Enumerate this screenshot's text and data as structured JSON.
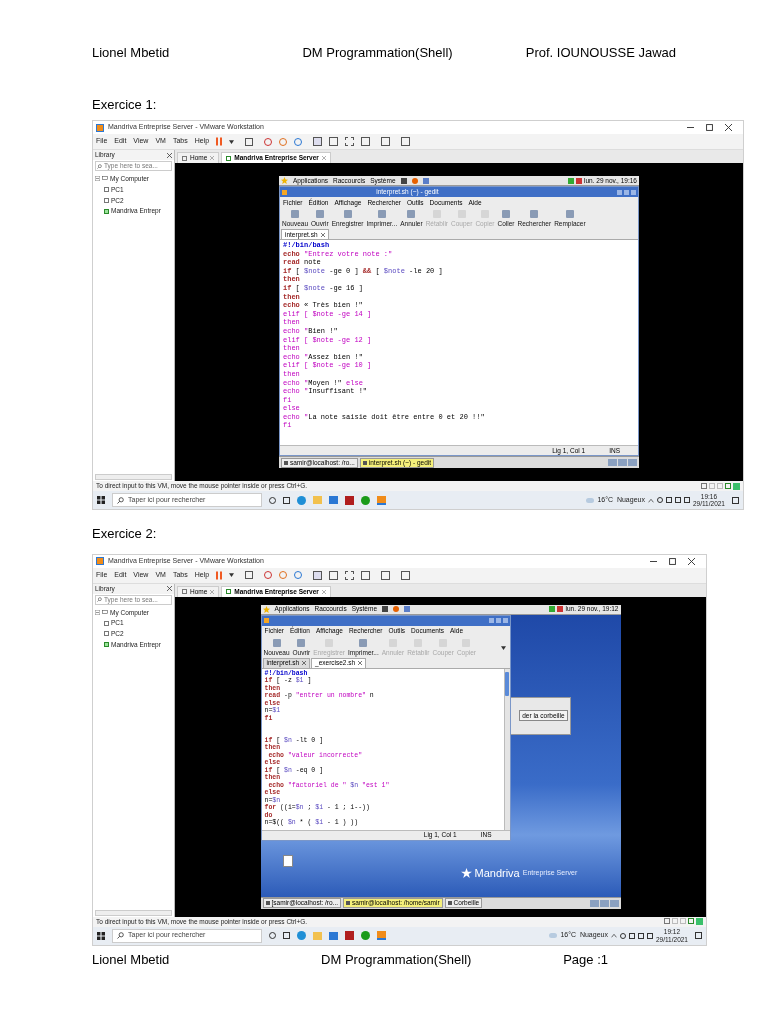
{
  "header": {
    "left": "Lionel Mbetid",
    "center": "DM Programmation(Shell)",
    "right": "Prof. IOUNOUSSE Jawad"
  },
  "sections": [
    {
      "title": "Exercice 1:",
      "screenshot": {
        "window_title": "Mandriva Entreprise Server - VMware Workstation",
        "menu": [
          "File",
          "Edit",
          "View",
          "VM",
          "Tabs",
          "Help"
        ],
        "library": {
          "title": "Library",
          "search_placeholder": "Type here to sea...",
          "tree": [
            {
              "label": "My Computer",
              "expanded": true,
              "children": [
                {
                  "label": "PC1",
                  "running": false
                },
                {
                  "label": "PC2",
                  "running": false
                },
                {
                  "label": "Mandriva Entrepr",
                  "running": true
                }
              ]
            }
          ]
        },
        "tabs": [
          {
            "label": "Home",
            "selected": false
          },
          {
            "label": "Mandriva Entreprise Server",
            "selected": true
          }
        ],
        "guest": {
          "kind": "maximized",
          "panel_menus": [
            "Applications",
            "Raccourcis",
            "Système"
          ],
          "panel_clock": "lun. 29 nov., 19:16",
          "gedit": {
            "title": "interpret.sh (~) - gedit",
            "menu": [
              "Fichier",
              "Édition",
              "Affichage",
              "Rechercher",
              "Outils",
              "Documents",
              "Aide"
            ],
            "toolbar": [
              {
                "label": "Nouveau",
                "disabled": false
              },
              {
                "label": "Ouvrir",
                "disabled": false
              },
              {
                "label": "Enregistrer",
                "disabled": false
              },
              {
                "label": "Imprimer...",
                "disabled": false
              },
              {
                "label": "Annuler",
                "disabled": false
              },
              {
                "label": "Rétablir",
                "disabled": true
              },
              {
                "label": "Couper",
                "disabled": true
              },
              {
                "label": "Copier",
                "disabled": true
              },
              {
                "label": "Coller",
                "disabled": false
              },
              {
                "label": "Rechercher",
                "disabled": false
              },
              {
                "label": "Remplacer",
                "disabled": false
              }
            ],
            "doc_tabs": [
              {
                "label": "interpret.sh",
                "selected": true
              }
            ],
            "lines": [
              {
                "kind": "code",
                "tokens": [
                  {
                    "kind": "shebang",
                    "text": "#!/bin/bash"
                  }
                ]
              },
              {
                "kind": "code",
                "tokens": [
                  {
                    "kind": "kw",
                    "text": "echo"
                  },
                  {
                    "kind": "str",
                    "text": " \"Entrez votre note :\""
                  }
                ]
              },
              {
                "kind": "code",
                "tokens": [
                  {
                    "kind": "kw",
                    "text": "read"
                  },
                  {
                    "kind": "plain",
                    "text": " note"
                  }
                ]
              },
              {
                "kind": "code",
                "tokens": [
                  {
                    "kind": "kw",
                    "text": "if"
                  },
                  {
                    "kind": "plain",
                    "text": " [ "
                  },
                  {
                    "kind": "var",
                    "text": "$note"
                  },
                  {
                    "kind": "plain",
                    "text": " -ge 0 ] "
                  },
                  {
                    "kind": "kw",
                    "text": "&&"
                  },
                  {
                    "kind": "plain",
                    "text": " [ "
                  },
                  {
                    "kind": "var",
                    "text": "$note"
                  },
                  {
                    "kind": "plain",
                    "text": " -le 20 ]"
                  }
                ]
              },
              {
                "kind": "code",
                "tokens": [
                  {
                    "kind": "kw",
                    "text": "then"
                  }
                ]
              },
              {
                "kind": "code",
                "tokens": [
                  {
                    "kind": "kw",
                    "text": "if"
                  },
                  {
                    "kind": "plain",
                    "text": " [ "
                  },
                  {
                    "kind": "var",
                    "text": "$note"
                  },
                  {
                    "kind": "plain",
                    "text": " -ge 16 ]"
                  }
                ]
              },
              {
                "kind": "code",
                "tokens": [
                  {
                    "kind": "kw",
                    "text": "then"
                  }
                ]
              },
              {
                "kind": "code",
                "tokens": [
                  {
                    "kind": "kw",
                    "text": "echo"
                  },
                  {
                    "kind": "plain",
                    "text": " « Très bien !\""
                  }
                ]
              },
              {
                "kind": "code",
                "tokens": [
                  {
                    "kind": "str",
                    "text": "elif [ $note -ge 14 ]"
                  }
                ]
              },
              {
                "kind": "code",
                "tokens": [
                  {
                    "kind": "str",
                    "text": "then"
                  }
                ]
              },
              {
                "kind": "code",
                "tokens": [
                  {
                    "kind": "str",
                    "text": "echo \""
                  },
                  {
                    "kind": "plain",
                    "text": "Bien !\""
                  }
                ]
              },
              {
                "kind": "code",
                "tokens": [
                  {
                    "kind": "str",
                    "text": "elif [ $note -ge 12 ]"
                  }
                ]
              },
              {
                "kind": "code",
                "tokens": [
                  {
                    "kind": "str",
                    "text": "then"
                  }
                ]
              },
              {
                "kind": "code",
                "tokens": [
                  {
                    "kind": "str",
                    "text": "echo \""
                  },
                  {
                    "kind": "plain",
                    "text": "Assez bien !\""
                  }
                ]
              },
              {
                "kind": "code",
                "tokens": [
                  {
                    "kind": "str",
                    "text": "elif [ $note -ge 10 ]"
                  }
                ]
              },
              {
                "kind": "code",
                "tokens": [
                  {
                    "kind": "str",
                    "text": "then"
                  }
                ]
              },
              {
                "kind": "code",
                "tokens": [
                  {
                    "kind": "str",
                    "text": "echo \""
                  },
                  {
                    "kind": "plain",
                    "text": "Moyen !\" "
                  },
                  {
                    "kind": "str",
                    "text": "else"
                  }
                ]
              },
              {
                "kind": "code",
                "tokens": [
                  {
                    "kind": "str",
                    "text": "echo \""
                  },
                  {
                    "kind": "plain",
                    "text": "Insuffisant !\""
                  }
                ]
              },
              {
                "kind": "code",
                "tokens": [
                  {
                    "kind": "str",
                    "text": "fi"
                  }
                ]
              },
              {
                "kind": "code",
                "tokens": [
                  {
                    "kind": "str",
                    "text": "else"
                  }
                ]
              },
              {
                "kind": "code",
                "tokens": [
                  {
                    "kind": "str",
                    "text": "echo \""
                  },
                  {
                    "kind": "plain",
                    "text": "La note saisie doit être entre 0 et 20 !!\""
                  }
                ]
              },
              {
                "kind": "code",
                "tokens": [
                  {
                    "kind": "str",
                    "text": "fi"
                  }
                ]
              }
            ],
            "cursor_position": "Lig 1, Col 1",
            "insert_mode": "INS"
          },
          "taskbar": [
            {
              "label": "samir@localhost: /ro...",
              "selected": false
            },
            {
              "label": "interpret.sh (~) - gedit",
              "selected": true
            }
          ]
        },
        "status_message": "To direct input to this VM, move the mouse pointer inside or press Ctrl+G.",
        "host_taskbar": {
          "search_placeholder": "Taper ici pour rechercher",
          "weather": "16°C  Nuageux",
          "time": "19:16",
          "date": "29/11/2021"
        }
      }
    },
    {
      "title": "Exercice 2:",
      "screenshot": {
        "window_title": "Mandriva Entreprise Server - VMware Workstation",
        "menu": [
          "File",
          "Edit",
          "View",
          "VM",
          "Tabs",
          "Help"
        ],
        "library": {
          "title": "Library",
          "search_placeholder": "Type here to sea...",
          "tree": [
            {
              "label": "My Computer",
              "expanded": true,
              "children": [
                {
                  "label": "PC1",
                  "running": false
                },
                {
                  "label": "PC2",
                  "running": false
                },
                {
                  "label": "Mandriva Entrepr",
                  "running": true
                }
              ]
            }
          ]
        },
        "tabs": [
          {
            "label": "Home",
            "selected": false
          },
          {
            "label": "Mandriva Entreprise Server",
            "selected": true
          }
        ],
        "guest": {
          "kind": "desktop",
          "panel_menus": [
            "Applications",
            "Raccourcis",
            "Système"
          ],
          "panel_clock": "lun. 29 nov., 19:12",
          "gedit": {
            "menu": [
              "Fichier",
              "Édition",
              "Affichage",
              "Rechercher",
              "Outils",
              "Documents",
              "Aide"
            ],
            "toolbar": [
              {
                "label": "Nouveau",
                "disabled": false
              },
              {
                "label": "Ouvrir",
                "disabled": false
              },
              {
                "label": "Enregistrer",
                "disabled": true
              },
              {
                "label": "Imprimer...",
                "disabled": false
              },
              {
                "label": "Annuler",
                "disabled": true
              },
              {
                "label": "Rétablir",
                "disabled": true
              },
              {
                "label": "Couper",
                "disabled": true
              },
              {
                "label": "Copier",
                "disabled": true
              }
            ],
            "doc_tabs": [
              {
                "label": "interpret.sh",
                "selected": false
              },
              {
                "label": "_exercise2.sh",
                "selected": true
              }
            ],
            "lines": [
              {
                "kind": "code",
                "tokens": [
                  {
                    "kind": "shebang",
                    "text": "#!/bin/bash"
                  }
                ]
              },
              {
                "kind": "code",
                "tokens": [
                  {
                    "kind": "kw",
                    "text": "if"
                  },
                  {
                    "kind": "plain",
                    "text": " [ -z "
                  },
                  {
                    "kind": "var",
                    "text": "$1"
                  },
                  {
                    "kind": "plain",
                    "text": " ]"
                  }
                ]
              },
              {
                "kind": "code",
                "tokens": [
                  {
                    "kind": "kw",
                    "text": "then"
                  }
                ]
              },
              {
                "kind": "code",
                "tokens": [
                  {
                    "kind": "kw",
                    "text": "read"
                  },
                  {
                    "kind": "plain",
                    "text": " -p "
                  },
                  {
                    "kind": "str",
                    "text": "\"entrer un nombre\""
                  },
                  {
                    "kind": "plain",
                    "text": " n"
                  }
                ]
              },
              {
                "kind": "code",
                "tokens": [
                  {
                    "kind": "kw",
                    "text": "else"
                  }
                ]
              },
              {
                "kind": "code",
                "tokens": [
                  {
                    "kind": "plain",
                    "text": "n="
                  },
                  {
                    "kind": "var",
                    "text": "$1"
                  }
                ]
              },
              {
                "kind": "code",
                "tokens": [
                  {
                    "kind": "kw",
                    "text": "fi"
                  }
                ]
              },
              {
                "kind": "blank"
              },
              {
                "kind": "blank"
              },
              {
                "kind": "code",
                "tokens": [
                  {
                    "kind": "kw",
                    "text": "if"
                  },
                  {
                    "kind": "plain",
                    "text": " [ "
                  },
                  {
                    "kind": "var",
                    "text": "$n"
                  },
                  {
                    "kind": "plain",
                    "text": " -lt 0 ]"
                  }
                ]
              },
              {
                "kind": "code",
                "tokens": [
                  {
                    "kind": "kw",
                    "text": "then"
                  }
                ]
              },
              {
                "kind": "code",
                "tokens": [
                  {
                    "kind": "kw",
                    "text": " echo"
                  },
                  {
                    "kind": "str",
                    "text": " \"valeur incorrecte\""
                  }
                ]
              },
              {
                "kind": "code",
                "tokens": [
                  {
                    "kind": "kw",
                    "text": "else"
                  }
                ]
              },
              {
                "kind": "code",
                "tokens": [
                  {
                    "kind": "kw",
                    "text": "if"
                  },
                  {
                    "kind": "plain",
                    "text": " [ "
                  },
                  {
                    "kind": "var",
                    "text": "$n"
                  },
                  {
                    "kind": "plain",
                    "text": " -eq 0 ]"
                  }
                ]
              },
              {
                "kind": "code",
                "tokens": [
                  {
                    "kind": "kw",
                    "text": "then"
                  }
                ]
              },
              {
                "kind": "code",
                "tokens": [
                  {
                    "kind": "kw",
                    "text": " echo"
                  },
                  {
                    "kind": "str",
                    "text": " \"factoriel de \""
                  },
                  {
                    "kind": "var",
                    "text": " $n"
                  },
                  {
                    "kind": "str",
                    "text": " \"est 1\""
                  }
                ]
              },
              {
                "kind": "code",
                "tokens": [
                  {
                    "kind": "kw",
                    "text": "else"
                  }
                ]
              },
              {
                "kind": "code",
                "tokens": [
                  {
                    "kind": "plain",
                    "text": "n="
                  },
                  {
                    "kind": "var",
                    "text": "$n"
                  }
                ]
              },
              {
                "kind": "code",
                "tokens": [
                  {
                    "kind": "kw",
                    "text": "for"
                  },
                  {
                    "kind": "plain",
                    "text": " ((i="
                  },
                  {
                    "kind": "var",
                    "text": "$n"
                  },
                  {
                    "kind": "plain",
                    "text": " ; "
                  },
                  {
                    "kind": "var",
                    "text": "$i"
                  },
                  {
                    "kind": "plain",
                    "text": " - 1 ; i--))"
                  }
                ]
              },
              {
                "kind": "code",
                "tokens": [
                  {
                    "kind": "kw",
                    "text": "do"
                  }
                ]
              },
              {
                "kind": "code",
                "tokens": [
                  {
                    "kind": "plain",
                    "text": "n=$(( "
                  },
                  {
                    "kind": "var",
                    "text": "$n"
                  },
                  {
                    "kind": "plain",
                    "text": " * ( "
                  },
                  {
                    "kind": "var",
                    "text": "$i"
                  },
                  {
                    "kind": "plain",
                    "text": " - 1 ) ))"
                  }
                ]
              }
            ],
            "cursor_position": "Lig 1, Col 1",
            "insert_mode": "INS"
          },
          "dialog_button": "der la corbeille",
          "logo": {
            "name": "Mandriva",
            "edition": "Entreprise Server"
          },
          "taskbar": [
            {
              "label": "[samir@localhost: /ro...",
              "selected": false
            },
            {
              "label": "samir@localhost: /home/samir",
              "selected": true
            },
            {
              "label": "Corbeille",
              "selected": false
            }
          ]
        },
        "status_message": "To direct input to this VM, move the mouse pointer inside or press Ctrl+G.",
        "host_taskbar": {
          "search_placeholder": "Taper ici pour rechercher",
          "weather": "16°C  Nuageux",
          "time": "19:12",
          "date": "29/11/2021"
        }
      }
    }
  ],
  "footer": {
    "left": "Lionel Mbetid",
    "center": "DM Programmation(Shell)",
    "right": "Page :1"
  }
}
